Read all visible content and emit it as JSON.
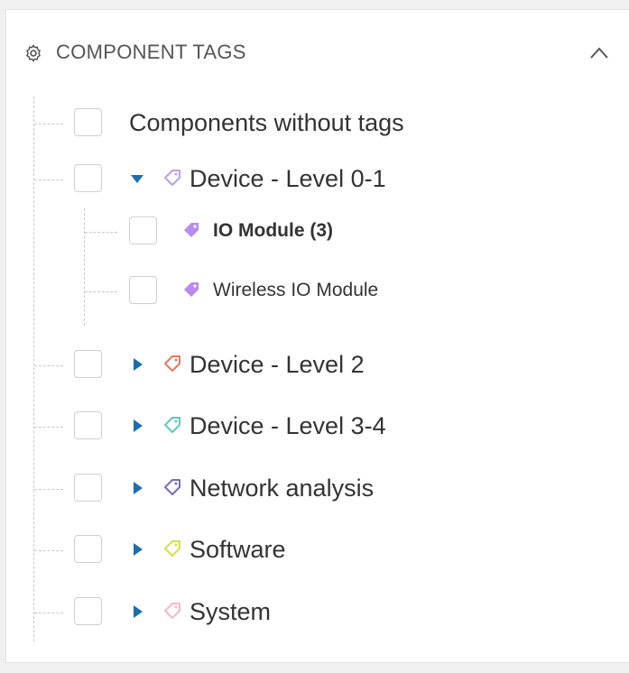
{
  "panel": {
    "title": "COMPONENT TAGS",
    "icons": {
      "header": "gear-icon",
      "collapse": "chevron-up-icon"
    }
  },
  "tree": [
    {
      "label": "Components without tags",
      "tag_color": null
    },
    {
      "label": "Device - Level 0-1",
      "tag_color": "#b99ff0",
      "expanded": true,
      "children": [
        {
          "label": "IO Module (3)",
          "tag_color": "#b98af0",
          "bold": true
        },
        {
          "label": "Wireless IO Module",
          "tag_color": "#b98af0",
          "bold": false
        }
      ]
    },
    {
      "label": "Device - Level 2",
      "tag_color": "#e07b62",
      "expanded": false
    },
    {
      "label": "Device - Level 3-4",
      "tag_color": "#5ec9c0",
      "expanded": false
    },
    {
      "label": "Network analysis",
      "tag_color": "#7b6cb0",
      "expanded": false
    },
    {
      "label": "Software",
      "tag_color": "#d6e045",
      "expanded": false
    },
    {
      "label": "System",
      "tag_color": "#f3b8c8",
      "expanded": false
    }
  ],
  "colors": {
    "caret": "#1b6fb0",
    "border": "#cfcfcf"
  }
}
